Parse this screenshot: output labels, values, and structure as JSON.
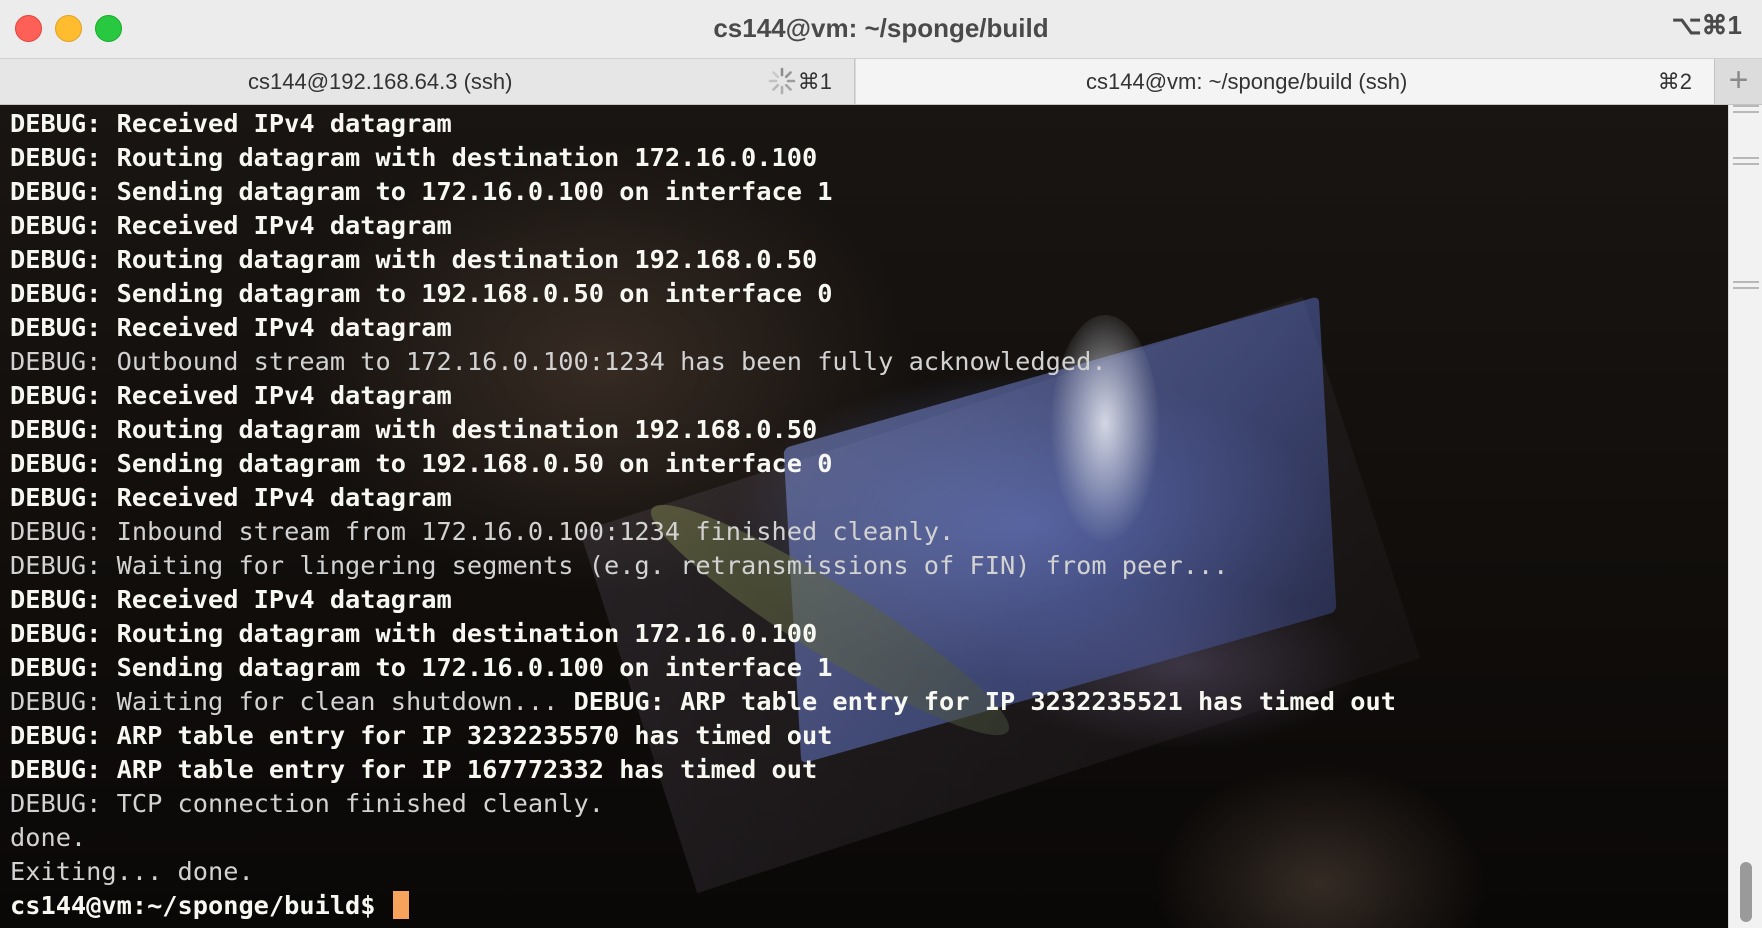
{
  "window": {
    "title": "cs144@vm: ~/sponge/build",
    "shortcut": "⌥⌘1"
  },
  "tabs": [
    {
      "label": "cs144@192.168.64.3 (ssh)",
      "shortcut": "⌘1",
      "loading": true,
      "active": false
    },
    {
      "label": "cs144@vm: ~/sponge/build (ssh)",
      "shortcut": "⌘2",
      "active": true
    }
  ],
  "new_tab_symbol": "+",
  "colors": {
    "bright_text": "#f8f8f2",
    "dim_text": "#d2d2d2",
    "cursor": "#f7a35c",
    "close": "#fe5f57",
    "minimize": "#febc2e",
    "maximize": "#28c840"
  },
  "terminal": {
    "lines": [
      {
        "segments": [
          {
            "text": "DEBUG: Received IPv4 datagram",
            "style": "bright"
          }
        ]
      },
      {
        "segments": [
          {
            "text": "DEBUG: Routing datagram with destination 172.16.0.100",
            "style": "bright"
          }
        ]
      },
      {
        "segments": [
          {
            "text": "DEBUG: Sending datagram to 172.16.0.100 on interface 1",
            "style": "bright"
          }
        ]
      },
      {
        "segments": [
          {
            "text": "DEBUG: Received IPv4 datagram",
            "style": "bright"
          }
        ]
      },
      {
        "segments": [
          {
            "text": "DEBUG: Routing datagram with destination 192.168.0.50",
            "style": "bright"
          }
        ]
      },
      {
        "segments": [
          {
            "text": "DEBUG: Sending datagram to 192.168.0.50 on interface 0",
            "style": "bright"
          }
        ]
      },
      {
        "segments": [
          {
            "text": "DEBUG: Received IPv4 datagram",
            "style": "bright"
          }
        ]
      },
      {
        "segments": [
          {
            "text": "DEBUG: Outbound stream to 172.16.0.100:1234 has been fully acknowledged.",
            "style": "dim"
          }
        ]
      },
      {
        "segments": [
          {
            "text": "DEBUG: Received IPv4 datagram",
            "style": "bright"
          }
        ]
      },
      {
        "segments": [
          {
            "text": "DEBUG: Routing datagram with destination 192.168.0.50",
            "style": "bright"
          }
        ]
      },
      {
        "segments": [
          {
            "text": "DEBUG: Sending datagram to 192.168.0.50 on interface 0",
            "style": "bright"
          }
        ]
      },
      {
        "segments": [
          {
            "text": "DEBUG: Received IPv4 datagram",
            "style": "bright"
          }
        ]
      },
      {
        "segments": [
          {
            "text": "DEBUG: Inbound stream from 172.16.0.100:1234 finished cleanly.",
            "style": "dim"
          }
        ]
      },
      {
        "segments": [
          {
            "text": "DEBUG: Waiting for lingering segments (e.g. retransmissions of FIN) from peer...",
            "style": "dim"
          }
        ]
      },
      {
        "segments": [
          {
            "text": "DEBUG: Received IPv4 datagram",
            "style": "bright"
          }
        ]
      },
      {
        "segments": [
          {
            "text": "DEBUG: Routing datagram with destination 172.16.0.100",
            "style": "bright"
          }
        ]
      },
      {
        "segments": [
          {
            "text": "DEBUG: Sending datagram to 172.16.0.100 on interface 1",
            "style": "bright"
          }
        ]
      },
      {
        "segments": [
          {
            "text": "DEBUG: Waiting for clean shutdown... ",
            "style": "dim"
          },
          {
            "text": "DEBUG: ARP table entry for IP 3232235521 has timed out",
            "style": "bright"
          }
        ]
      },
      {
        "segments": [
          {
            "text": "DEBUG: ARP table entry for IP 3232235570 has timed out",
            "style": "bright"
          }
        ]
      },
      {
        "segments": [
          {
            "text": "DEBUG: ARP table entry for IP 167772332 has timed out",
            "style": "bright"
          }
        ]
      },
      {
        "segments": [
          {
            "text": "DEBUG: TCP connection finished cleanly.",
            "style": "dim"
          }
        ]
      },
      {
        "segments": [
          {
            "text": "done.",
            "style": "dim"
          }
        ]
      },
      {
        "segments": [
          {
            "text": "Exiting... done.",
            "style": "dim"
          }
        ]
      }
    ],
    "prompt": "cs144@vm:~/sponge/build$ "
  }
}
